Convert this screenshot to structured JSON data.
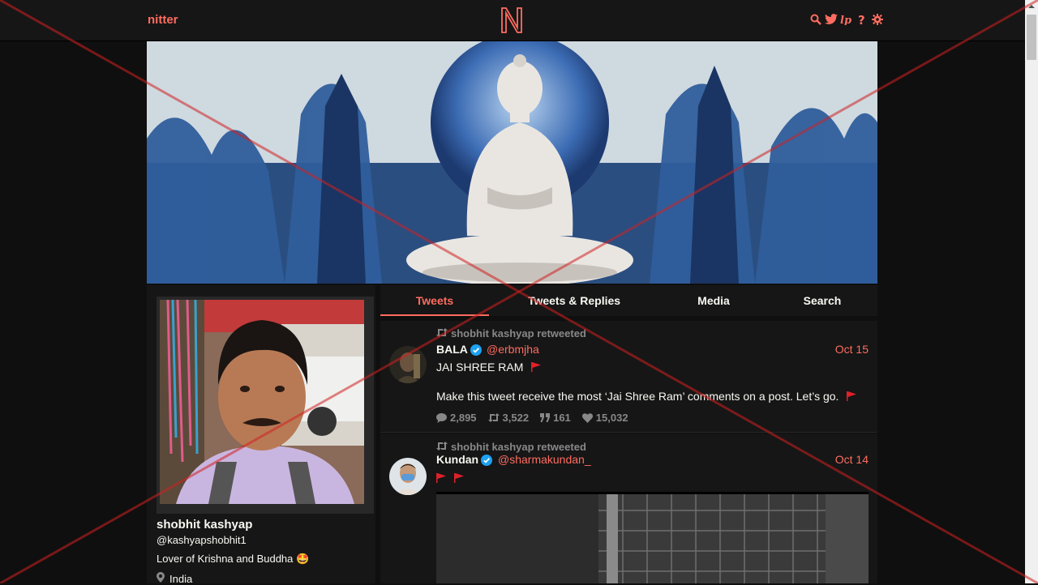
{
  "nav": {
    "brand": "nitter",
    "logo_letter": "N",
    "icons": [
      "search-icon",
      "twitter-bird-icon",
      "lp-icon",
      "help-icon",
      "settings-icon"
    ]
  },
  "profile": {
    "fullname": "shobhit kashyap",
    "username": "@kashyapshobhit1",
    "bio": "Lover of Krishna and Buddha 🤩",
    "location": "India"
  },
  "tabs": [
    {
      "label": "Tweets",
      "active": true
    },
    {
      "label": "Tweets & Replies",
      "active": false
    },
    {
      "label": "Media",
      "active": false
    },
    {
      "label": "Search",
      "active": false
    }
  ],
  "tweets": [
    {
      "retweet_label": "shobhit kashyap retweeted",
      "fullname": "BALA",
      "handle": "@erbmjha",
      "date": "Oct 15",
      "text_line1": "JAI SHREE RAM",
      "text_line2": "Make this tweet receive the most ‘Jai Shree Ram’ comments on a post. Let’s go.",
      "stats": {
        "replies": "2,895",
        "retweets": "3,522",
        "quotes": "161",
        "likes": "15,032"
      }
    },
    {
      "retweet_label": "shobhit kashyap retweeted",
      "fullname": "Kundan",
      "handle": "@sharmakundan_",
      "date": "Oct 14",
      "text_line1": ""
    }
  ],
  "colors": {
    "accent": "#ff6c60",
    "background": "#0f0f0f",
    "panel": "#161616",
    "muted": "#888888",
    "verified": "#1da1f2"
  }
}
